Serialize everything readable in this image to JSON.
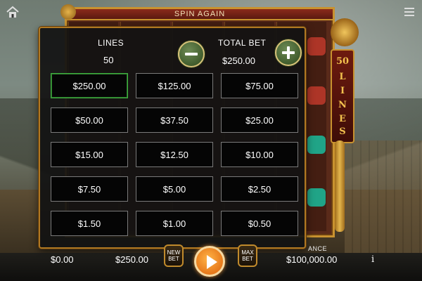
{
  "top_bar": {
    "title": "SPIN AGAIN"
  },
  "side_banner": {
    "number": "50",
    "word": [
      "L",
      "I",
      "N",
      "E",
      "S"
    ]
  },
  "overlay": {
    "lines_label": "LINES",
    "lines_value": "50",
    "total_bet_label": "TOTAL BET",
    "total_bet_value": "$250.00",
    "selected_bet": "$250.00",
    "bets": [
      "$250.00",
      "$125.00",
      "$75.00",
      "$50.00",
      "$37.50",
      "$25.00",
      "$15.00",
      "$12.50",
      "$10.00",
      "$7.50",
      "$5.00",
      "$2.50",
      "$1.50",
      "$1.00",
      "$0.50"
    ]
  },
  "bottom": {
    "win_value": "$0.00",
    "bet_value": "$250.00",
    "new_bet_label": "NEW BET",
    "max_bet_label": "MAX BET",
    "balance_label": "ANCE",
    "balance_value": "$100,000.00",
    "info_symbol": "i"
  },
  "icons": {
    "home": "home-icon",
    "menu": "menu-icon",
    "minus": "minus-icon",
    "plus": "plus-icon",
    "spin": "play-icon",
    "info": "info-icon"
  },
  "colors": {
    "frame_gold": "#c9922f",
    "selected_border": "#3fae3f",
    "spin_orange": "#e6781a"
  }
}
